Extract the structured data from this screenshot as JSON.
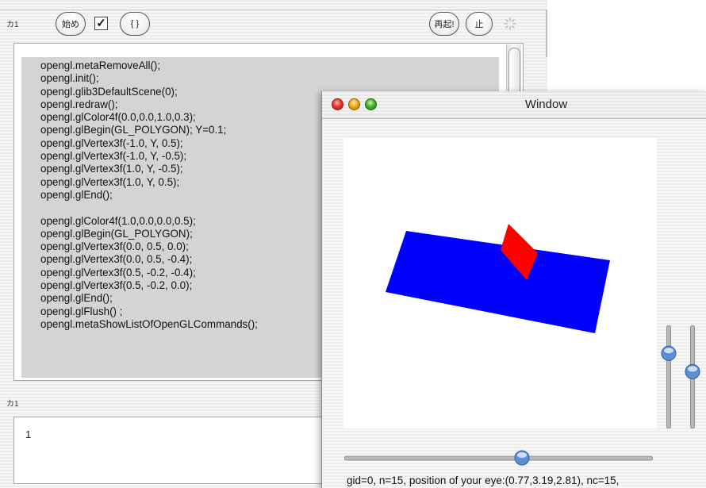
{
  "editor": {
    "top_panel_label": "カ1",
    "toolbar": {
      "start_label": "始め",
      "check_mark": "✓",
      "braces_label": "{ }",
      "restart_label": "再起!",
      "stop_label": "止"
    },
    "code_lines": [
      "opengl.metaRemoveAll();",
      "opengl.init();",
      "opengl.glib3DefaultScene(0);",
      "opengl.redraw();",
      "opengl.glColor4f(0.0,0.0,1.0,0.3);",
      "opengl.glBegin(GL_POLYGON); Y=0.1;",
      "opengl.glVertex3f(-1.0, Y, 0.5);",
      "opengl.glVertex3f(-1.0, Y, -0.5);",
      "opengl.glVertex3f(1.0, Y, -0.5);",
      "opengl.glVertex3f(1.0, Y, 0.5);",
      "opengl.glEnd();",
      "",
      "opengl.glColor4f(1.0,0.0,0.0,0.5);",
      "opengl.glBegin(GL_POLYGON);",
      "opengl.glVertex3f(0.0, 0.5, 0.0);",
      "opengl.glVertex3f(0.0, 0.5, -0.4);",
      "opengl.glVertex3f(0.5, -0.2, -0.4);",
      "opengl.glVertex3f(0.5, -0.2, 0.0);",
      "opengl.glEnd();",
      "opengl.glFlush() ;",
      "opengl.metaShowListOfOpenGLCommands();"
    ],
    "output_panel_label": "カ1",
    "output_text": "1"
  },
  "gl_window": {
    "title": "Window",
    "status_text": "gid=0, n=15, position of your eye:(0.77,3.19,2.81), nc=15,",
    "colors": {
      "plane": "#0000ff",
      "quad": "#ff0000"
    },
    "horizontal_slider_value": 0.58,
    "left_vertical_slider_value": 0.77,
    "right_vertical_slider_value": 0.56
  }
}
